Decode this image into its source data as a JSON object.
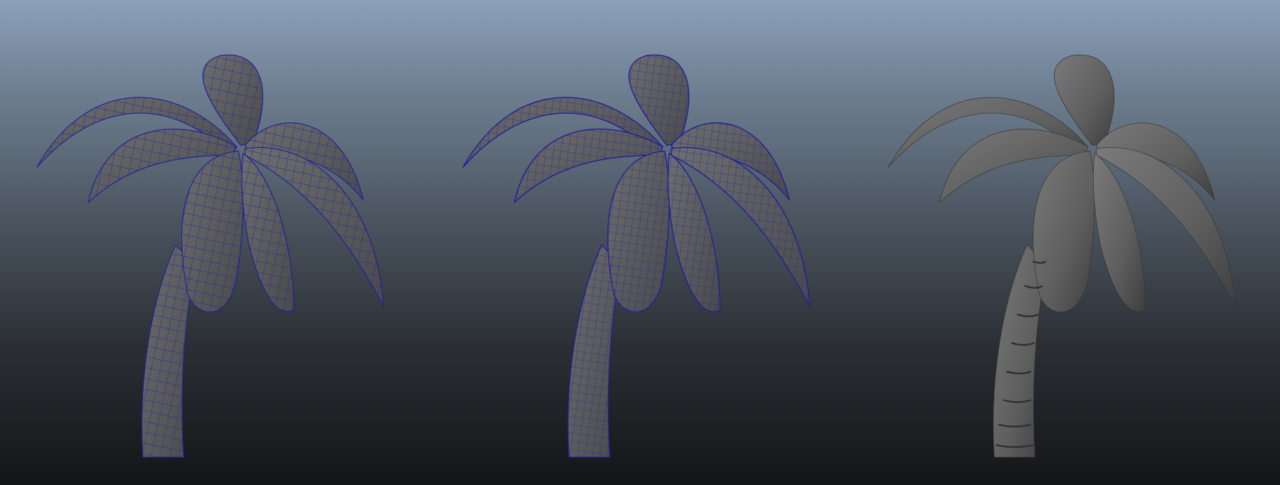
{
  "viewport": {
    "background_top": "#8ba0b9",
    "background_bottom": "#141518",
    "wire_color": "#1f1f9a",
    "surface_color": "#5c5c5c"
  }
}
